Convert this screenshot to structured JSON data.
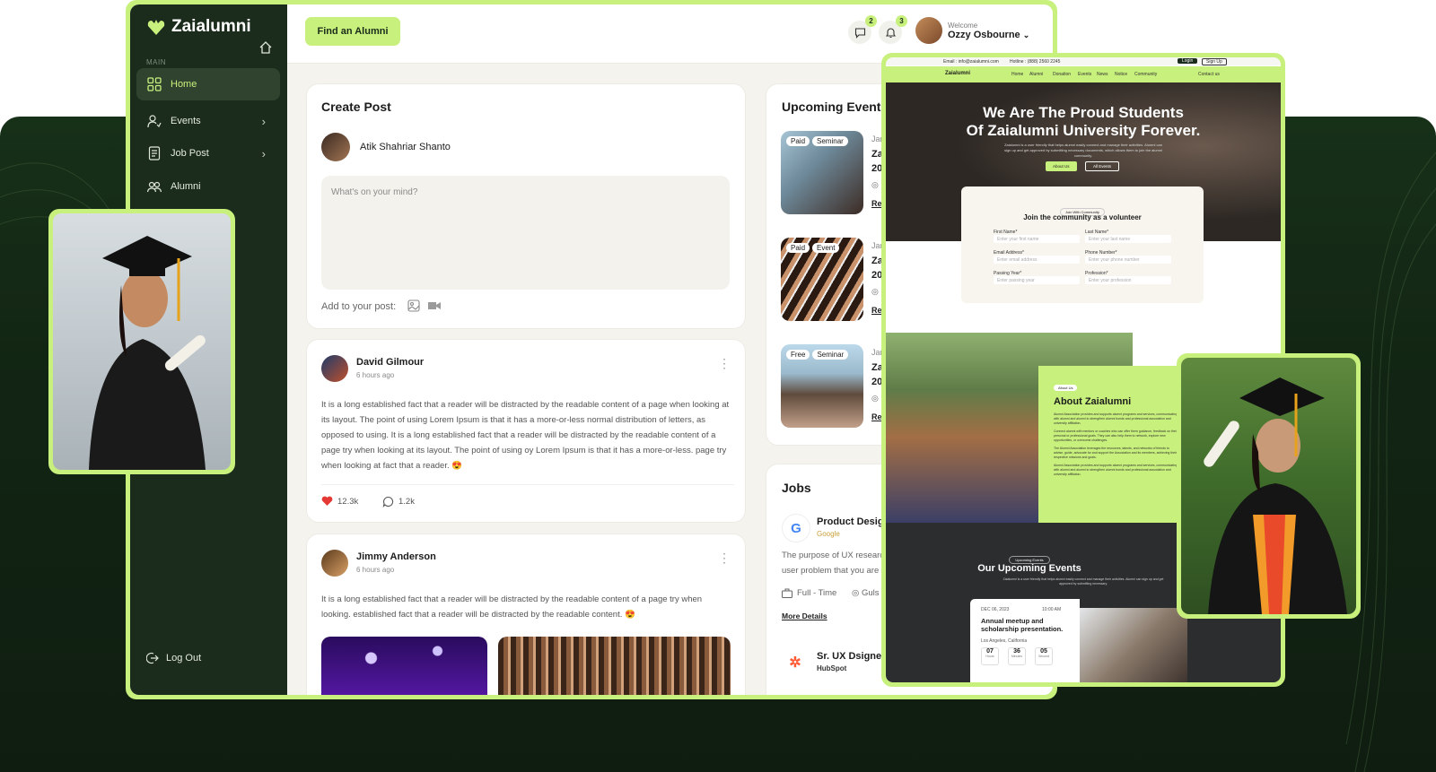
{
  "brand": {
    "name": "Zaialumni",
    "accent": "#c8f07c",
    "dark": "#1b2c1c"
  },
  "sidebar": {
    "section": "MAIN",
    "items": [
      {
        "label": "Home",
        "icon": "grid-icon",
        "active": true
      },
      {
        "label": "Events",
        "icon": "users-icon",
        "has_submenu": true
      },
      {
        "label": "Job Post",
        "icon": "document-icon",
        "has_submenu": true
      },
      {
        "label": "Alumni",
        "icon": "group-icon"
      }
    ],
    "logout": "Log Out"
  },
  "topbar": {
    "find_button": "Find an Alumni",
    "messages_count": "2",
    "notifications_count": "3",
    "welcome": "Welcome",
    "user_name": "Ozzy Osbourne"
  },
  "create_post": {
    "title": "Create Post",
    "author": "Atik Shahriar Shanto",
    "placeholder": "What's on your mind?",
    "add_label": "Add to your post:"
  },
  "posts": [
    {
      "author": "David Gilmour",
      "time": "6 hours ago",
      "text": "It is a long established fact that a reader will be distracted by the readable content of a page when looking at its layout. The point of using Lorem Ipsum is that it has a more-or-less normal distribution of letters, as opposed to using. It is a long established fact that a reader will be distracted by the readable content of a page try when looking at its layout. The point of using oy Lorem Ipsum is that it has a more-or-less. page try when looking at fact that a reader. 😍",
      "likes": "12.3k",
      "comments": "1.2k"
    },
    {
      "author": "Jimmy Anderson",
      "time": "6 hours ago",
      "text": "It is a long established fact that a reader will be distracted by the readable content of a page try when looking. established fact that a reader will be distracted by the readable content. 😍"
    }
  ],
  "events": {
    "title": "Upcoming Events",
    "items": [
      {
        "tags": [
          "Paid",
          "Seminar"
        ],
        "date": "Jar",
        "name": "Zai",
        "year": "20",
        "loc": "D",
        "link": "Res"
      },
      {
        "tags": [
          "Paid",
          "Event"
        ],
        "date": "Jar",
        "name": "Zai",
        "year": "20",
        "loc": "D",
        "link": "Res"
      },
      {
        "tags": [
          "Free",
          "Seminar"
        ],
        "date": "Jar",
        "name": "Zai",
        "year": "20",
        "loc": "D",
        "link": "Res"
      }
    ]
  },
  "jobs": {
    "title": "Jobs",
    "items": [
      {
        "title": "Product Design",
        "company": "Google",
        "desc_1": "The purpose of UX researc",
        "desc_2": "user problem that you are t",
        "type": "Full - Time",
        "loc": "Guls",
        "more": "More Details"
      },
      {
        "title": "Sr. UX Dsigner",
        "company": "HubSpot"
      }
    ]
  },
  "website": {
    "top_email": "Email : info@zaialumni.com",
    "top_hotline": "Hotline : (888) 2560 2245",
    "login": "Login",
    "signup": "Sign Up",
    "nav": [
      "Home",
      "Alumni",
      "Donation",
      "Events",
      "News",
      "Notice",
      "Community"
    ],
    "contact": "Contact us",
    "hero_title_1": "We Are The Proud Students",
    "hero_title_2": "Of Zaialumni University Forever.",
    "hero_sub": "Zaialumni is a user friendly that helps alumni easily connect and manage their activities. Alumni can sign up and get approved by submitting necessary documents, which allows them to join the alumni community.",
    "hero_btn_1": "About Us",
    "hero_btn_2": "All Events",
    "form_badge": "Join With Community",
    "form_title": "Join the community as a volunteer",
    "fields": [
      {
        "label": "First Name*",
        "placeholder": "Enter your first name"
      },
      {
        "label": "Last Name*",
        "placeholder": "Enter your last name"
      },
      {
        "label": "Email Address*",
        "placeholder": "Enter email address"
      },
      {
        "label": "Phone Number*",
        "placeholder": "Enter your phone number"
      },
      {
        "label": "Passing Year*",
        "placeholder": "Enter passing year"
      },
      {
        "label": "Profession*",
        "placeholder": "Enter your profession"
      }
    ],
    "about_badge": "About Us",
    "about_title": "About Zaialumni",
    "about_points": [
      "Alumni Association provides and supports alumni programs and services, communicating with alumni and alumni to strengthen alumni bonds and professional association and university affiliation.",
      "Connect alumni with mentors or coaches who can offer them guidance, feedback on their personal or professional goals. They can also help them to network, explore new opportunities, or overcome challenges.",
      "The Alumni Association leverages the resources, talents, and networks of friends to advise, guide, advocate for and support the Association and its members, achieving their respective missions and goals.",
      "Alumni Association provides and supports alumni programs and services, communicating with alumni and alumni to strengthen alumni bonds and professional association and university affiliation."
    ],
    "events_badge": "Upcoming Events",
    "events_title": "Our Upcoming Events",
    "events_sub": "Zaialumni is a user friendly that helps alumni easily connect and manage their activities. Alumni can sign up and get approved by submitting necessary.",
    "event_date": "DEC 06, 2023",
    "event_time": "10:00 AM",
    "event_name": "Annual meetup and scholarship presentation.",
    "event_loc": "Los Angeles, California",
    "countdown": [
      {
        "v": "07",
        "l": "Hours"
      },
      {
        "v": "36",
        "l": "Minutes"
      },
      {
        "v": "05",
        "l": "Second"
      }
    ]
  }
}
